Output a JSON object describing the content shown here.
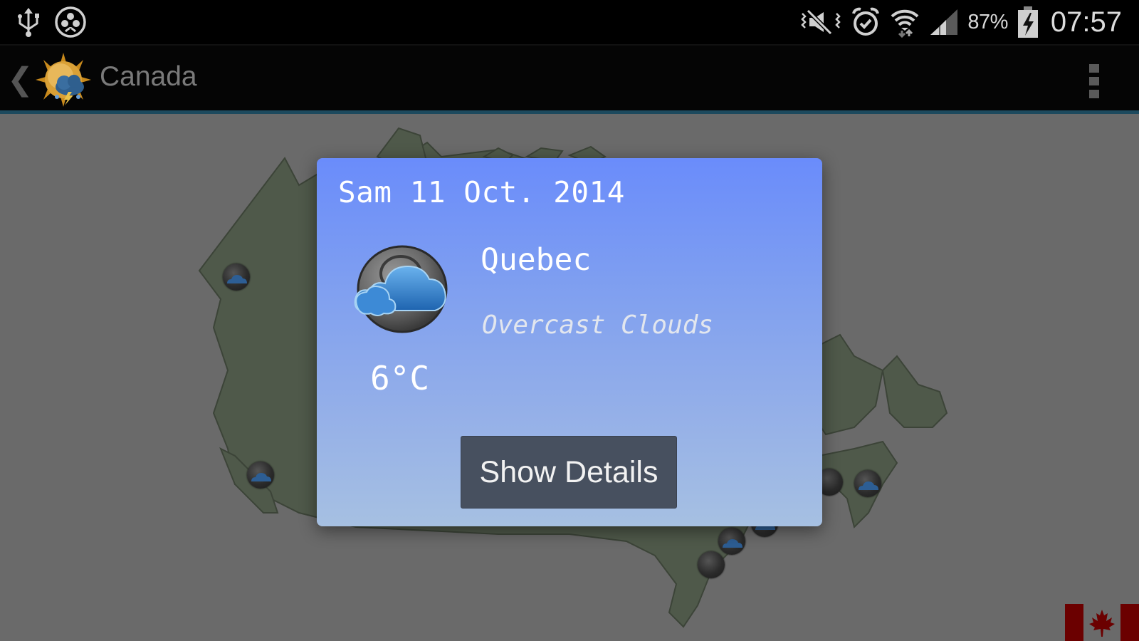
{
  "status_bar": {
    "left_icons": [
      "usb-icon",
      "sync-icon"
    ],
    "right_icons": [
      "vibrate-mute-icon",
      "alarm-icon",
      "wifi-icon",
      "signal-icon",
      "battery-charging-icon"
    ],
    "battery_percent": "87%",
    "time": "07:57"
  },
  "action_bar": {
    "title": "Canada",
    "back_icon": "chevron-left-icon",
    "logo_icon": "sun-cloud-storm-icon",
    "menu_icon": "overflow-menu-icon",
    "accent_color": "#1d4a5e"
  },
  "map": {
    "region": "Canada",
    "markers": [
      {
        "condition": "overcast-clouds"
      },
      {
        "condition": "overcast-clouds"
      },
      {
        "condition": "clear-night"
      },
      {
        "condition": "overcast-clouds"
      },
      {
        "condition": "overcast-clouds"
      },
      {
        "condition": "overcast-clouds"
      },
      {
        "condition": "clear-night"
      }
    ],
    "flag": "canada-flag-icon"
  },
  "dialog": {
    "date": "Sam 11 Oct. 2014",
    "city": "Quebec",
    "condition": "Overcast Clouds",
    "temperature": "6°C",
    "weather_icon": "moon-cloud-icon",
    "button_label": "Show Details"
  }
}
